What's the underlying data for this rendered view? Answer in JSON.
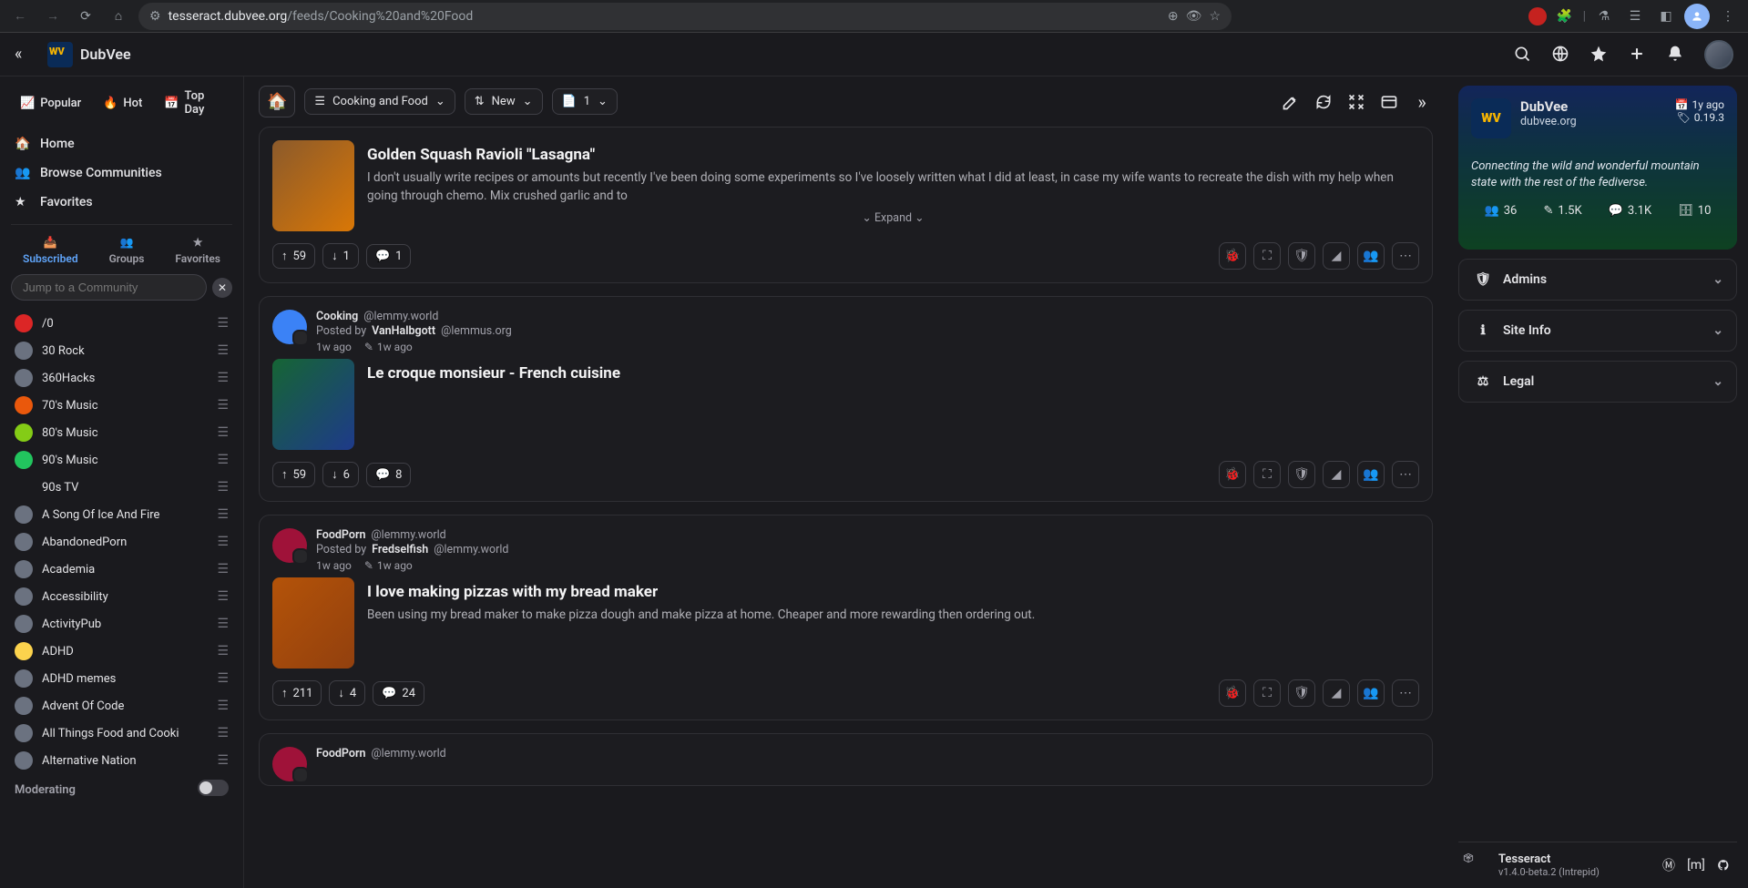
{
  "browser": {
    "url_host": "tesseract.dubvee.org",
    "url_path": "/feeds/Cooking%20and%20Food"
  },
  "brand": {
    "name": "DubVee"
  },
  "topnav_icons": [
    "search",
    "globe",
    "star",
    "plus",
    "bell"
  ],
  "sidebar": {
    "top_tabs": [
      {
        "label": "Popular",
        "icon": "trending"
      },
      {
        "label": "Hot",
        "icon": "flame"
      },
      {
        "label": "Top Day",
        "icon": "calendar"
      }
    ],
    "links": [
      {
        "label": "Home",
        "icon": "home"
      },
      {
        "label": "Browse Communities",
        "icon": "users"
      },
      {
        "label": "Favorites",
        "icon": "star"
      }
    ],
    "inner_tabs": [
      {
        "label": "Subscribed",
        "active": true
      },
      {
        "label": "Groups",
        "active": false
      },
      {
        "label": "Favorites",
        "active": false
      }
    ],
    "jump_placeholder": "Jump to a Community",
    "communities": [
      "/0",
      "30 Rock",
      "360Hacks",
      "70's Music",
      "80's Music",
      "90's Music",
      "90s TV",
      "A Song Of Ice And Fire",
      "AbandonedPorn",
      "Academia",
      "Accessibility",
      "ActivityPub",
      "ADHD",
      "ADHD memes",
      "Advent Of Code",
      "All Things Food and Cooki",
      "Alternative Nation"
    ],
    "moderating_label": "Moderating"
  },
  "toolbar": {
    "feed_name": "Cooking and Food",
    "sort": "New",
    "page": "1"
  },
  "posts": [
    {
      "title": "Golden Squash Ravioli \"Lasagna\"",
      "body": "I don't usually write recipes or amounts but recently I've been doing some experiments so I've loosely written what I did at least, in case my wife wants to recreate the dish with my help when going through chemo. Mix crushed garlic and to",
      "expand": "Expand",
      "up": "59",
      "down": "1",
      "comments": "1",
      "thumb_class": ""
    },
    {
      "community": "Cooking",
      "community_domain": "@lemmy.world",
      "posted_by": "Posted by ",
      "author": "VanHalbgott",
      "author_domain": "@lemmus.org",
      "age": "1w ago",
      "edit_age": "1w ago",
      "title": "Le croque monsieur - French cuisine",
      "up": "59",
      "down": "6",
      "comments": "8",
      "thumb_class": "b"
    },
    {
      "community": "FoodPorn",
      "community_domain": "@lemmy.world",
      "posted_by": "Posted by ",
      "author": "Fredselfish",
      "author_domain": "@lemmy.world",
      "age": "1w ago",
      "edit_age": "1w ago",
      "title": "I love making pizzas with my bread maker",
      "body": "Been using my bread maker to make pizza dough and make pizza at home. Cheaper and more rewarding then ordering out.",
      "up": "211",
      "down": "4",
      "comments": "24",
      "thumb_class": "c",
      "avatar_class": "fp"
    },
    {
      "community": "FoodPorn",
      "community_domain": "@lemmy.world"
    }
  ],
  "instance": {
    "name": "DubVee",
    "domain": "dubvee.org",
    "age": "1y ago",
    "version": "0.19.3",
    "desc": "Connecting the wild and wonderful mountain state with the rest of the fediverse.",
    "stats": {
      "users": "36",
      "posts": "1.5K",
      "comments": "3.1K",
      "communities": "10"
    }
  },
  "accordions": [
    "Admins",
    "Site Info",
    "Legal"
  ],
  "footer": {
    "name": "Tesseract",
    "version": "v1.4.0-beta.2 (Intrepid)"
  }
}
